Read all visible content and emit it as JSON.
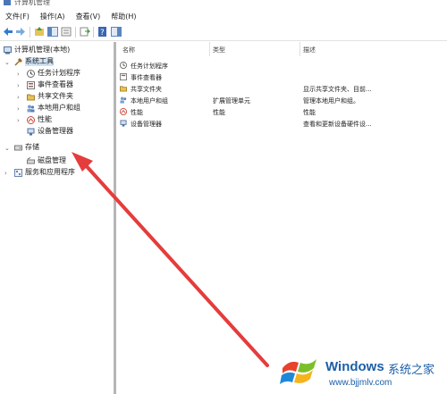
{
  "window": {
    "title": "计算机管理"
  },
  "menu": [
    "文件(F)",
    "操作(A)",
    "查看(V)",
    "帮助(H)"
  ],
  "tree": {
    "root": "计算机管理(本地)",
    "system_tools": "系统工具",
    "children": [
      "任务计划程序",
      "事件查看器",
      "共享文件夹",
      "本地用户和组",
      "性能",
      "设备管理器"
    ],
    "storage": "存储",
    "disk_management": "磁盘管理",
    "services": "服务和应用程序"
  },
  "table": {
    "columns": [
      "名称",
      "类型",
      "描述"
    ],
    "rows": [
      {
        "name": "任务计划程序",
        "type": "",
        "desc": ""
      },
      {
        "name": "事件查看器",
        "type": "",
        "desc": ""
      },
      {
        "name": "共享文件夹",
        "type": "",
        "desc": "显示共享文件夹、目前..."
      },
      {
        "name": "本地用户和组",
        "type": "扩展管理单元",
        "desc": "管理本地用户和组。"
      },
      {
        "name": "性能",
        "type": "性能",
        "desc": "性能"
      },
      {
        "name": "设备管理器",
        "type": "",
        "desc": "查看和更新设备硬件设..."
      }
    ]
  },
  "watermark": {
    "brand": "Windows",
    "suffix": "系统之家",
    "url": "www.bjjmlv.com"
  },
  "colors": {
    "accent": "#1c5fa8",
    "arrow": "#e53c3c",
    "selection": "#cfe3f5"
  }
}
